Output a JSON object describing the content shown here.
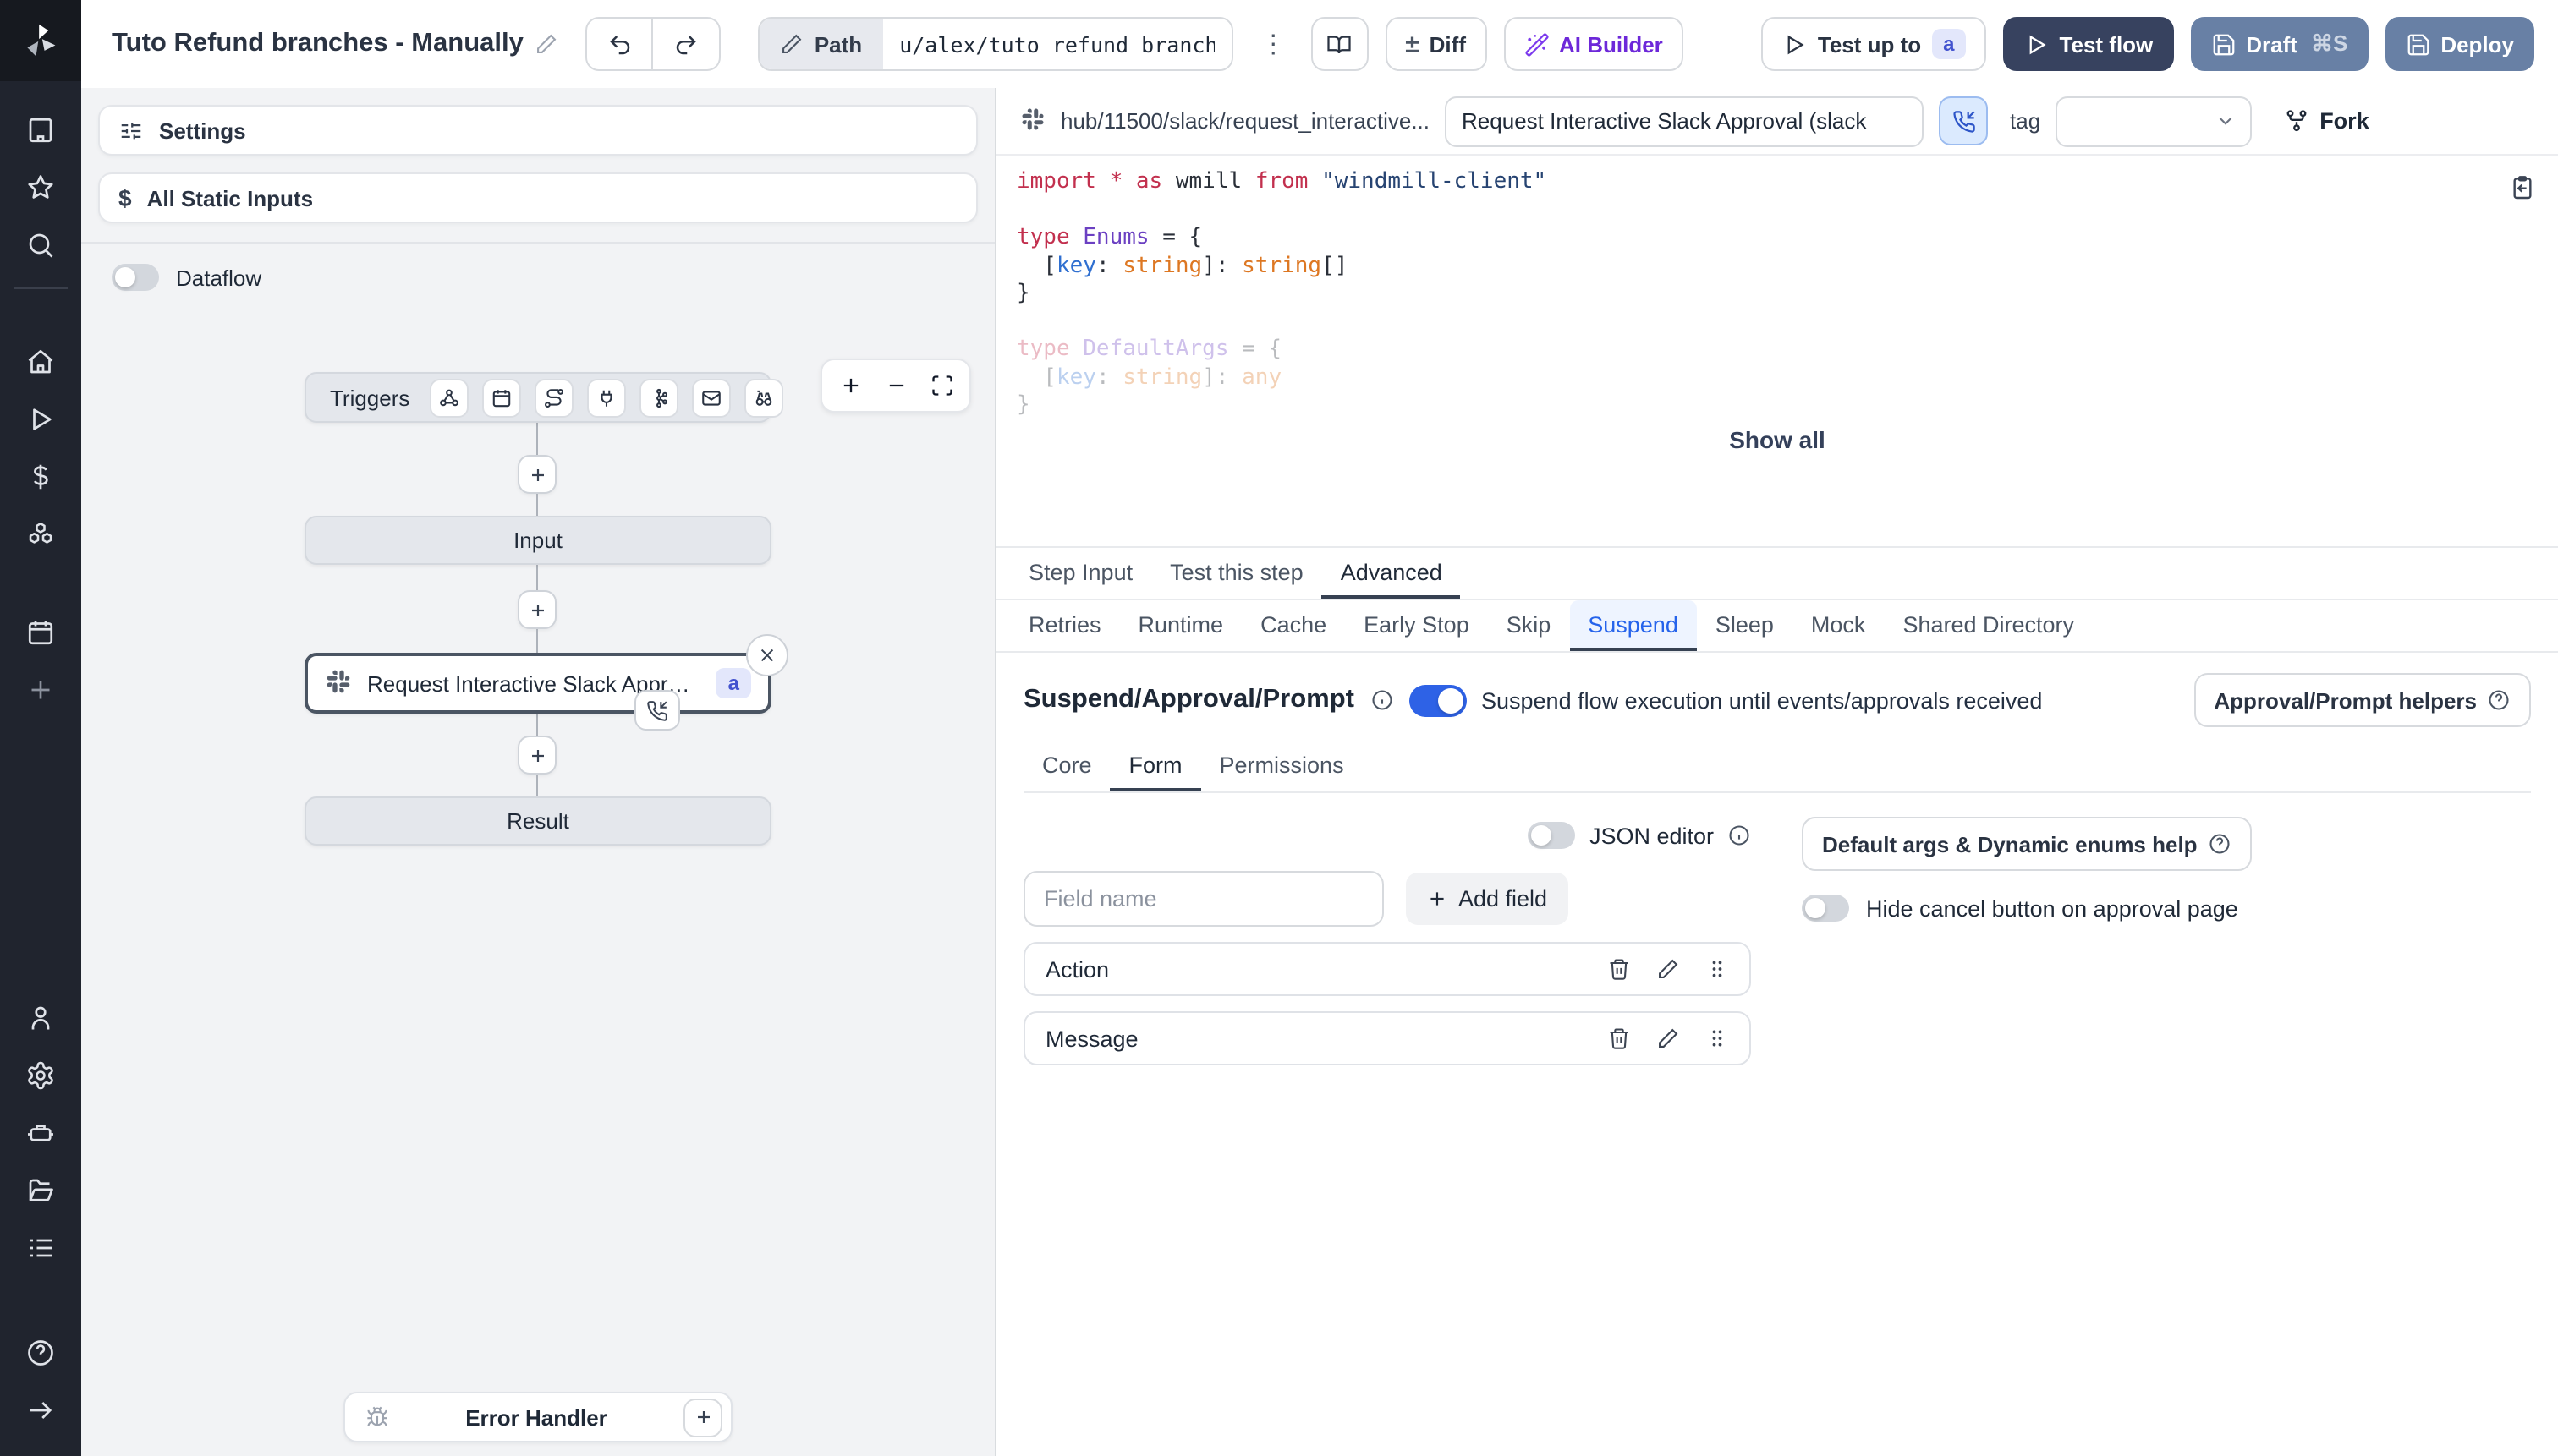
{
  "topbar": {
    "title": "Tuto Refund branches - Manually",
    "path_label": "Path",
    "path_value": "u/alex/tuto_refund_branches__",
    "dots_glyph": "⋮",
    "diff_label": "Diff",
    "diff_glyph": "±",
    "ai_builder_label": "AI Builder",
    "test_up_to_label": "Test up to",
    "test_up_to_badge": "a",
    "test_flow_label": "Test flow",
    "draft_label": "Draft",
    "draft_shortcut": "⌘S",
    "deploy_label": "Deploy"
  },
  "left_panel": {
    "settings_label": "Settings",
    "static_inputs_label": "All Static Inputs",
    "static_inputs_glyph": "$",
    "dataflow_label": "Dataflow",
    "graph": {
      "triggers_label": "Triggers",
      "input_label": "Input",
      "step_label": "Request Interactive Slack Approval (...",
      "step_badge": "a",
      "result_label": "Result",
      "error_handler_label": "Error Handler"
    }
  },
  "editor": {
    "hub_path": "hub/11500/slack/request_interactive...",
    "title_value": "Request Interactive Slack Approval (slack",
    "tag_label": "tag",
    "fork_label": "Fork",
    "show_all_label": "Show all",
    "code_lines": [
      {
        "s": [
          {
            "c": "kw",
            "t": "import"
          },
          {
            "c": "pl",
            "t": " "
          },
          {
            "c": "kw",
            "t": "*"
          },
          {
            "c": "pl",
            "t": " "
          },
          {
            "c": "kw",
            "t": "as"
          },
          {
            "c": "pl",
            "t": " wmill "
          },
          {
            "c": "kw",
            "t": "from"
          },
          {
            "c": "pl",
            "t": " "
          },
          {
            "c": "str",
            "t": "\"windmill-client\""
          }
        ]
      },
      {
        "s": []
      },
      {
        "s": [
          {
            "c": "kw",
            "t": "type"
          },
          {
            "c": "pl",
            "t": " "
          },
          {
            "c": "ty",
            "t": "Enums"
          },
          {
            "c": "pl",
            "t": " = {"
          }
        ]
      },
      {
        "s": [
          {
            "c": "pl",
            "t": "  ["
          },
          {
            "c": "vr",
            "t": "key"
          },
          {
            "c": "pl",
            "t": ": "
          },
          {
            "c": "or",
            "t": "string"
          },
          {
            "c": "pl",
            "t": "]: "
          },
          {
            "c": "or",
            "t": "string"
          },
          {
            "c": "pl",
            "t": "[]"
          }
        ]
      },
      {
        "s": [
          {
            "c": "pl",
            "t": "}"
          }
        ]
      },
      {
        "s": []
      },
      {
        "faded": true,
        "s": [
          {
            "c": "kw",
            "t": "type"
          },
          {
            "c": "pl",
            "t": " "
          },
          {
            "c": "ty",
            "t": "DefaultArgs"
          },
          {
            "c": "pl",
            "t": " = {"
          }
        ]
      },
      {
        "faded": true,
        "s": [
          {
            "c": "pl",
            "t": "  ["
          },
          {
            "c": "vr",
            "t": "key"
          },
          {
            "c": "pl",
            "t": ": "
          },
          {
            "c": "or",
            "t": "string"
          },
          {
            "c": "pl",
            "t": "]: "
          },
          {
            "c": "or",
            "t": "any"
          }
        ]
      },
      {
        "faded": true,
        "s": [
          {
            "c": "pl",
            "t": "}"
          }
        ]
      }
    ]
  },
  "tabs": {
    "row1": [
      "Step Input",
      "Test this step",
      "Advanced"
    ],
    "row1_selected": "Advanced",
    "row2": [
      "Retries",
      "Runtime",
      "Cache",
      "Early Stop",
      "Skip",
      "Suspend",
      "Sleep",
      "Mock",
      "Shared Directory"
    ],
    "row2_selected": "Suspend"
  },
  "suspend": {
    "heading": "Suspend/Approval/Prompt",
    "toggle_on": true,
    "description": "Suspend flow execution until events/approvals received",
    "helpers_button": "Approval/Prompt helpers",
    "sub_tabs": [
      "Core",
      "Form",
      "Permissions"
    ],
    "sub_selected": "Form",
    "json_editor_label": "JSON editor",
    "field_name_placeholder": "Field name",
    "add_field_label": "Add field",
    "fields": [
      "Action",
      "Message"
    ],
    "default_args_button": "Default args & Dynamic enums help",
    "hide_cancel_label": "Hide cancel button on approval page"
  },
  "colors": {
    "accent_blue": "#2563eb",
    "toggle_on": "#2e62e6",
    "navy_button": "#37425f",
    "slate_button": "#6880a5",
    "ai_purple": "#7c3aed",
    "badge_bg": "#e3e7fb",
    "badge_text": "#4353cf",
    "rail_bg": "#20242e",
    "panel_bg": "#f2f3f5"
  }
}
